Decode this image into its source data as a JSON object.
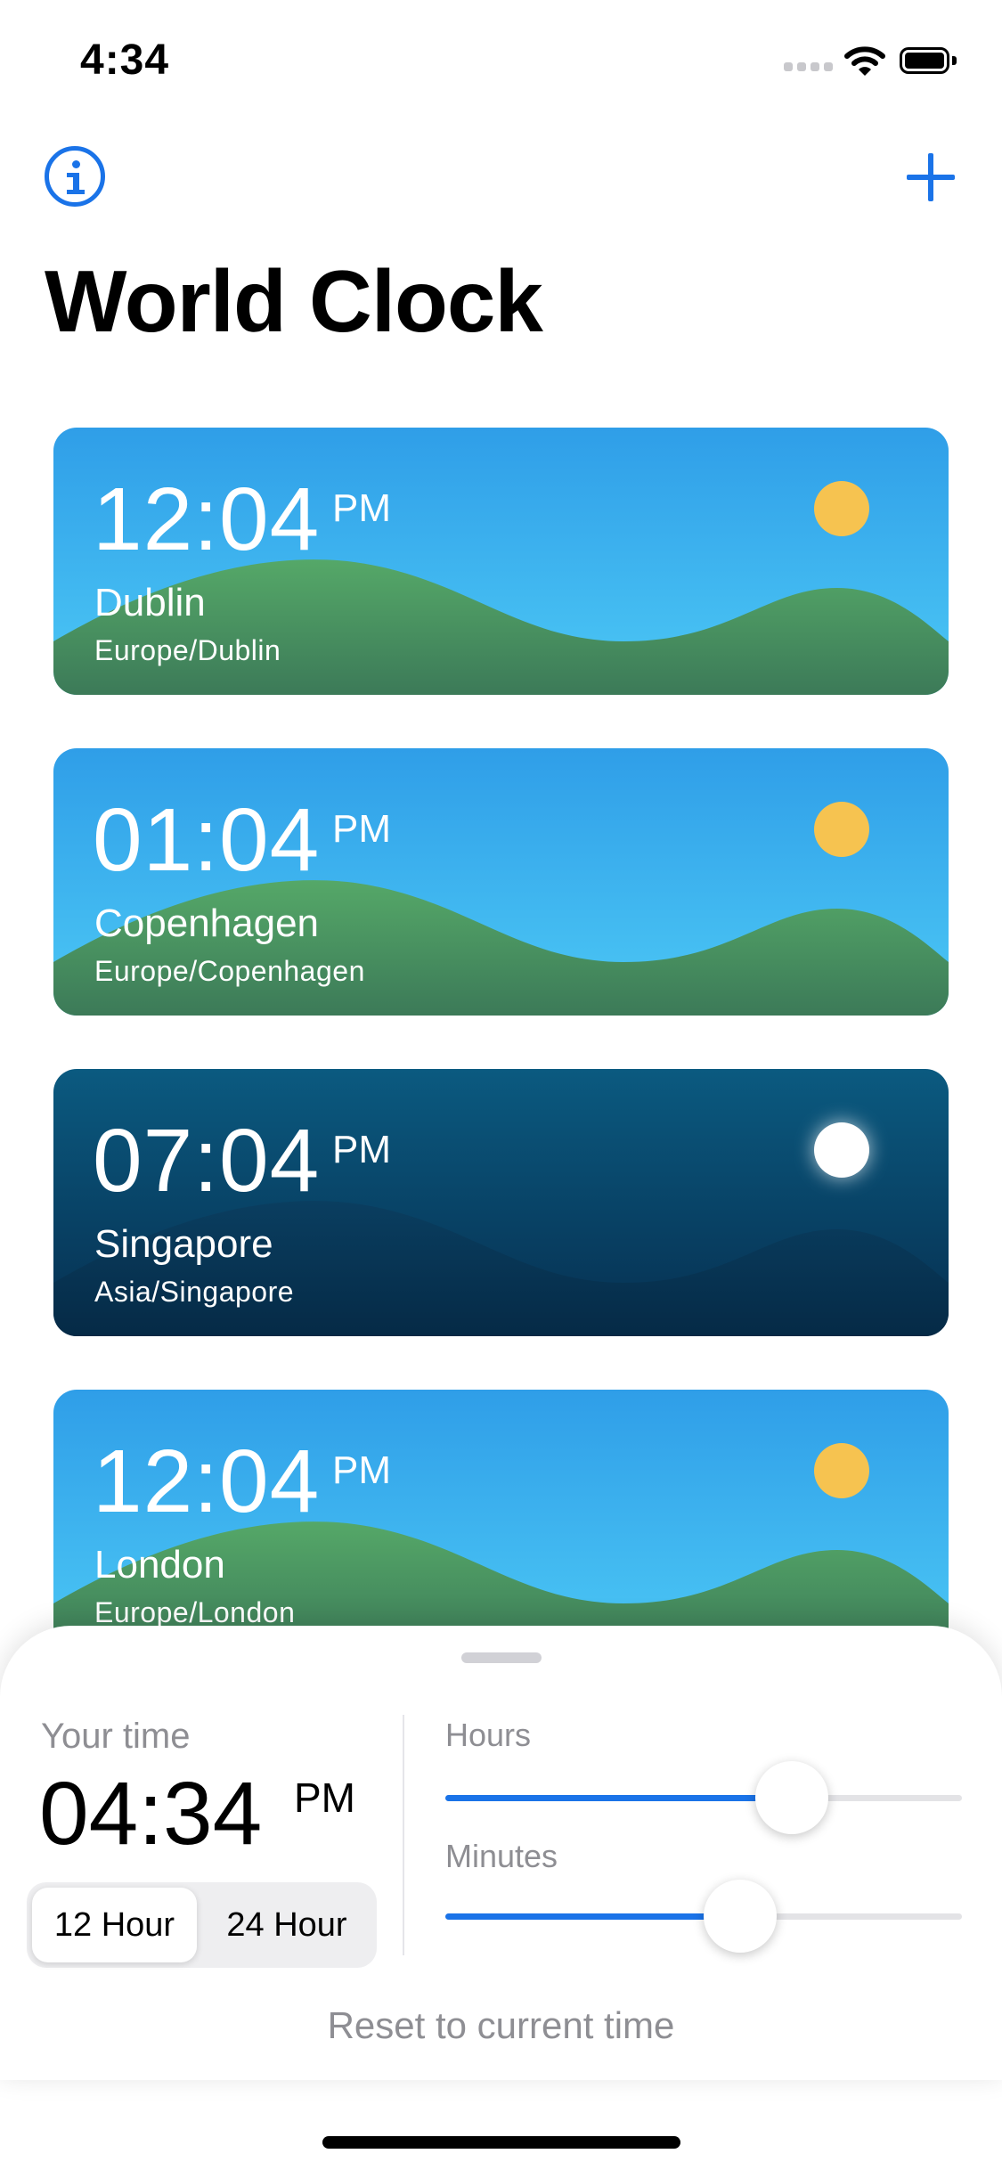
{
  "status_bar": {
    "time": "4:34"
  },
  "nav": {
    "title": "World Clock"
  },
  "clocks": [
    {
      "time": "12:04",
      "ampm": "PM",
      "city": "Dublin",
      "zone": "Europe/Dublin",
      "theme": "day"
    },
    {
      "time": "01:04",
      "ampm": "PM",
      "city": "Copenhagen",
      "zone": "Europe/Copenhagen",
      "theme": "day"
    },
    {
      "time": "07:04",
      "ampm": "PM",
      "city": "Singapore",
      "zone": "Asia/Singapore",
      "theme": "night"
    },
    {
      "time": "12:04",
      "ampm": "PM",
      "city": "London",
      "zone": "Europe/London",
      "theme": "day"
    }
  ],
  "sheet": {
    "your_time_label": "Your time",
    "time": "04:34",
    "ampm": "PM",
    "format_options": [
      "12 Hour",
      "24 Hour"
    ],
    "selected_format": "12 Hour",
    "hours_label": "Hours",
    "minutes_label": "Minutes",
    "hours_value": 0.67,
    "minutes_value": 0.57,
    "reset_label": "Reset to current time"
  },
  "colors": {
    "accent": "#1a73e8",
    "day_sky_top": "#2f9ee8",
    "day_sky_bottom": "#4cc8f5",
    "day_hill": "#4a9a62",
    "sun": "#f6c350",
    "night_sky_top": "#0b5a80",
    "night_sky_bottom": "#062f50",
    "moon": "#ffffff"
  }
}
